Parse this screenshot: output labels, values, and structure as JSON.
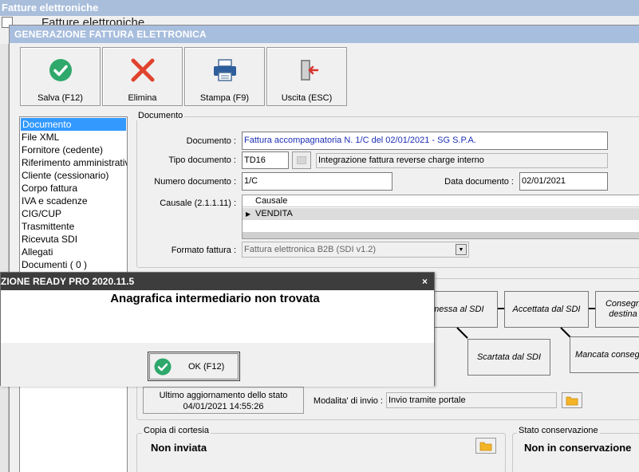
{
  "outer_window": {
    "title": "Fatture elettroniche",
    "ghost_text": "Fatture elettroniche"
  },
  "window": {
    "title": "GENERAZIONE FATTURA ELETTRONICA"
  },
  "toolbar": {
    "save": {
      "label": "Salva (F12)",
      "icon": "check-circle-icon",
      "color": "#2fa86b"
    },
    "delete": {
      "label": "Elimina",
      "icon": "close-x-icon",
      "color": "#e0442e"
    },
    "print": {
      "label": "Stampa (F9)",
      "icon": "printer-icon",
      "color": "#2e5e9c"
    },
    "exit": {
      "label": "Uscita (ESC)",
      "icon": "exit-door-icon",
      "color": "#d9322e"
    }
  },
  "nav": {
    "items": [
      "Documento",
      "File XML",
      "Fornitore (cedente)",
      "Riferimento amministrativo",
      "Cliente (cessionario)",
      "Corpo fattura",
      "IVA e scadenze",
      "CIG/CUP",
      "Trasmittente",
      "Ricevuta SDI",
      "Allegati",
      "Documenti ( 0 )"
    ],
    "selected": "Documento"
  },
  "documento": {
    "group_title": "Documento",
    "documento_label": "Documento :",
    "documento_value": "Fattura accompagnatoria N. 1/C del 02/01/2021 - SG S.P.A.",
    "tipo_label": "Tipo documento :",
    "tipo_value": "TD16",
    "tipo_desc": "Integrazione fattura reverse charge interno",
    "numero_label": "Numero documento :",
    "numero_value": "1/C",
    "data_label": "Data documento :",
    "data_value": "02/01/2021",
    "causale_label": "Causale (2.1.1.11) :",
    "causale_header": "Causale",
    "causale_row": "VENDITA",
    "formato_label": "Formato fattura :",
    "formato_value": "Fattura elettronica B2B (SDI v1.2)"
  },
  "states": {
    "trasmessa": "asmessa al SDI",
    "accettata": "Accettata dal SDI",
    "consegnata_1": "Consegn",
    "consegnata_2": "destina",
    "scartata": "Scartata dal SDI",
    "mancata": "Mancata consegn"
  },
  "status": {
    "last_update_label": "Ultimo aggiornamento dello stato",
    "last_update_value": "04/01/2021 14:55:26",
    "invio_label": "Modalita' di invio :",
    "invio_value": "Invio tramite portale"
  },
  "copia": {
    "group_title": "Copia di cortesia",
    "value": "Non inviata"
  },
  "conservazione": {
    "group_title": "Stato conservazione",
    "value": "Non in conservazione"
  },
  "dialog": {
    "title": "ZIONE READY PRO 2020.11.5",
    "close": "×",
    "message": "Anagrafica intermediario non trovata",
    "ok_label": "OK (F12)"
  }
}
